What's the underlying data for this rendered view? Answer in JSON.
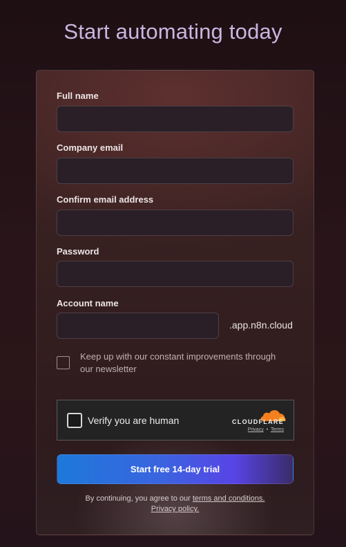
{
  "page": {
    "title": "Start automating today"
  },
  "form": {
    "full_name": {
      "label": "Full name",
      "value": ""
    },
    "company_email": {
      "label": "Company email",
      "value": ""
    },
    "confirm_email": {
      "label": "Confirm email address",
      "value": ""
    },
    "password": {
      "label": "Password",
      "value": ""
    },
    "account_name": {
      "label": "Account name",
      "value": "",
      "suffix": ".app.n8n.cloud"
    },
    "newsletter": {
      "label": "Keep up with our constant improvements through our newsletter",
      "checked": false
    }
  },
  "captcha": {
    "label": "Verify you are human",
    "checked": false,
    "brand": "CLOUDFLARE",
    "privacy_link": "Privacy",
    "separator": "•",
    "terms_link": "Terms",
    "brand_color": "#f38020"
  },
  "cta": {
    "label": "Start free 14-day trial"
  },
  "legal": {
    "prefix": "By continuing, you agree to our",
    "terms_link": "terms and conditions.",
    "privacy_link": "Privacy policy."
  },
  "colors": {
    "title": "#c9b6e0",
    "cta_start": "#1d79d9",
    "cta_end": "#5844e6"
  }
}
